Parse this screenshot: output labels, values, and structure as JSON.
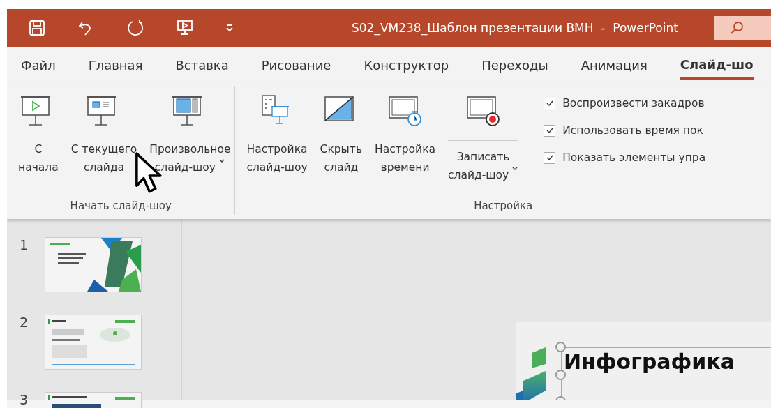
{
  "window": {
    "title": "S02_VM238_Шаблон презентации ВМН  -  PowerPoint"
  },
  "tabs": [
    {
      "label": "Файл",
      "selected": false
    },
    {
      "label": "Главная",
      "selected": false
    },
    {
      "label": "Вставка",
      "selected": false
    },
    {
      "label": "Рисование",
      "selected": false
    },
    {
      "label": "Конструктор",
      "selected": false
    },
    {
      "label": "Переходы",
      "selected": false
    },
    {
      "label": "Анимация",
      "selected": false
    },
    {
      "label": "Слайд-шо",
      "selected": true
    }
  ],
  "ribbon": {
    "groups": [
      {
        "label": "Начать слайд-шоу",
        "buttons": [
          {
            "kind": "start",
            "lines": [
              "С",
              "начала"
            ],
            "dropdown": false
          },
          {
            "kind": "current",
            "lines": [
              "С текущего",
              "слайда"
            ],
            "dropdown": false
          },
          {
            "kind": "custom",
            "lines": [
              "Произвольное",
              "слайд-шоу"
            ],
            "dropdown": true
          }
        ]
      },
      {
        "label": "Настройка",
        "buttons": [
          {
            "kind": "setup",
            "lines": [
              "Настройка",
              "слайд-шоу"
            ],
            "dropdown": false
          },
          {
            "kind": "hide",
            "lines": [
              "Скрыть",
              "слайд"
            ],
            "dropdown": false
          },
          {
            "kind": "timing",
            "lines": [
              "Настройка",
              "времени"
            ],
            "dropdown": false
          },
          {
            "kind": "record",
            "lines": [
              "Записать",
              "слайд-шоу"
            ],
            "dropdown": true
          }
        ],
        "checkboxes": [
          {
            "label": "Воспроизвести закадров",
            "checked": true
          },
          {
            "label": "Использовать время пок",
            "checked": true
          },
          {
            "label": "Показать элементы упра",
            "checked": true
          }
        ]
      }
    ]
  },
  "slides": [
    {
      "number": "1"
    },
    {
      "number": "2"
    },
    {
      "number": "3"
    }
  ],
  "slide": {
    "title": "Инфографика"
  }
}
